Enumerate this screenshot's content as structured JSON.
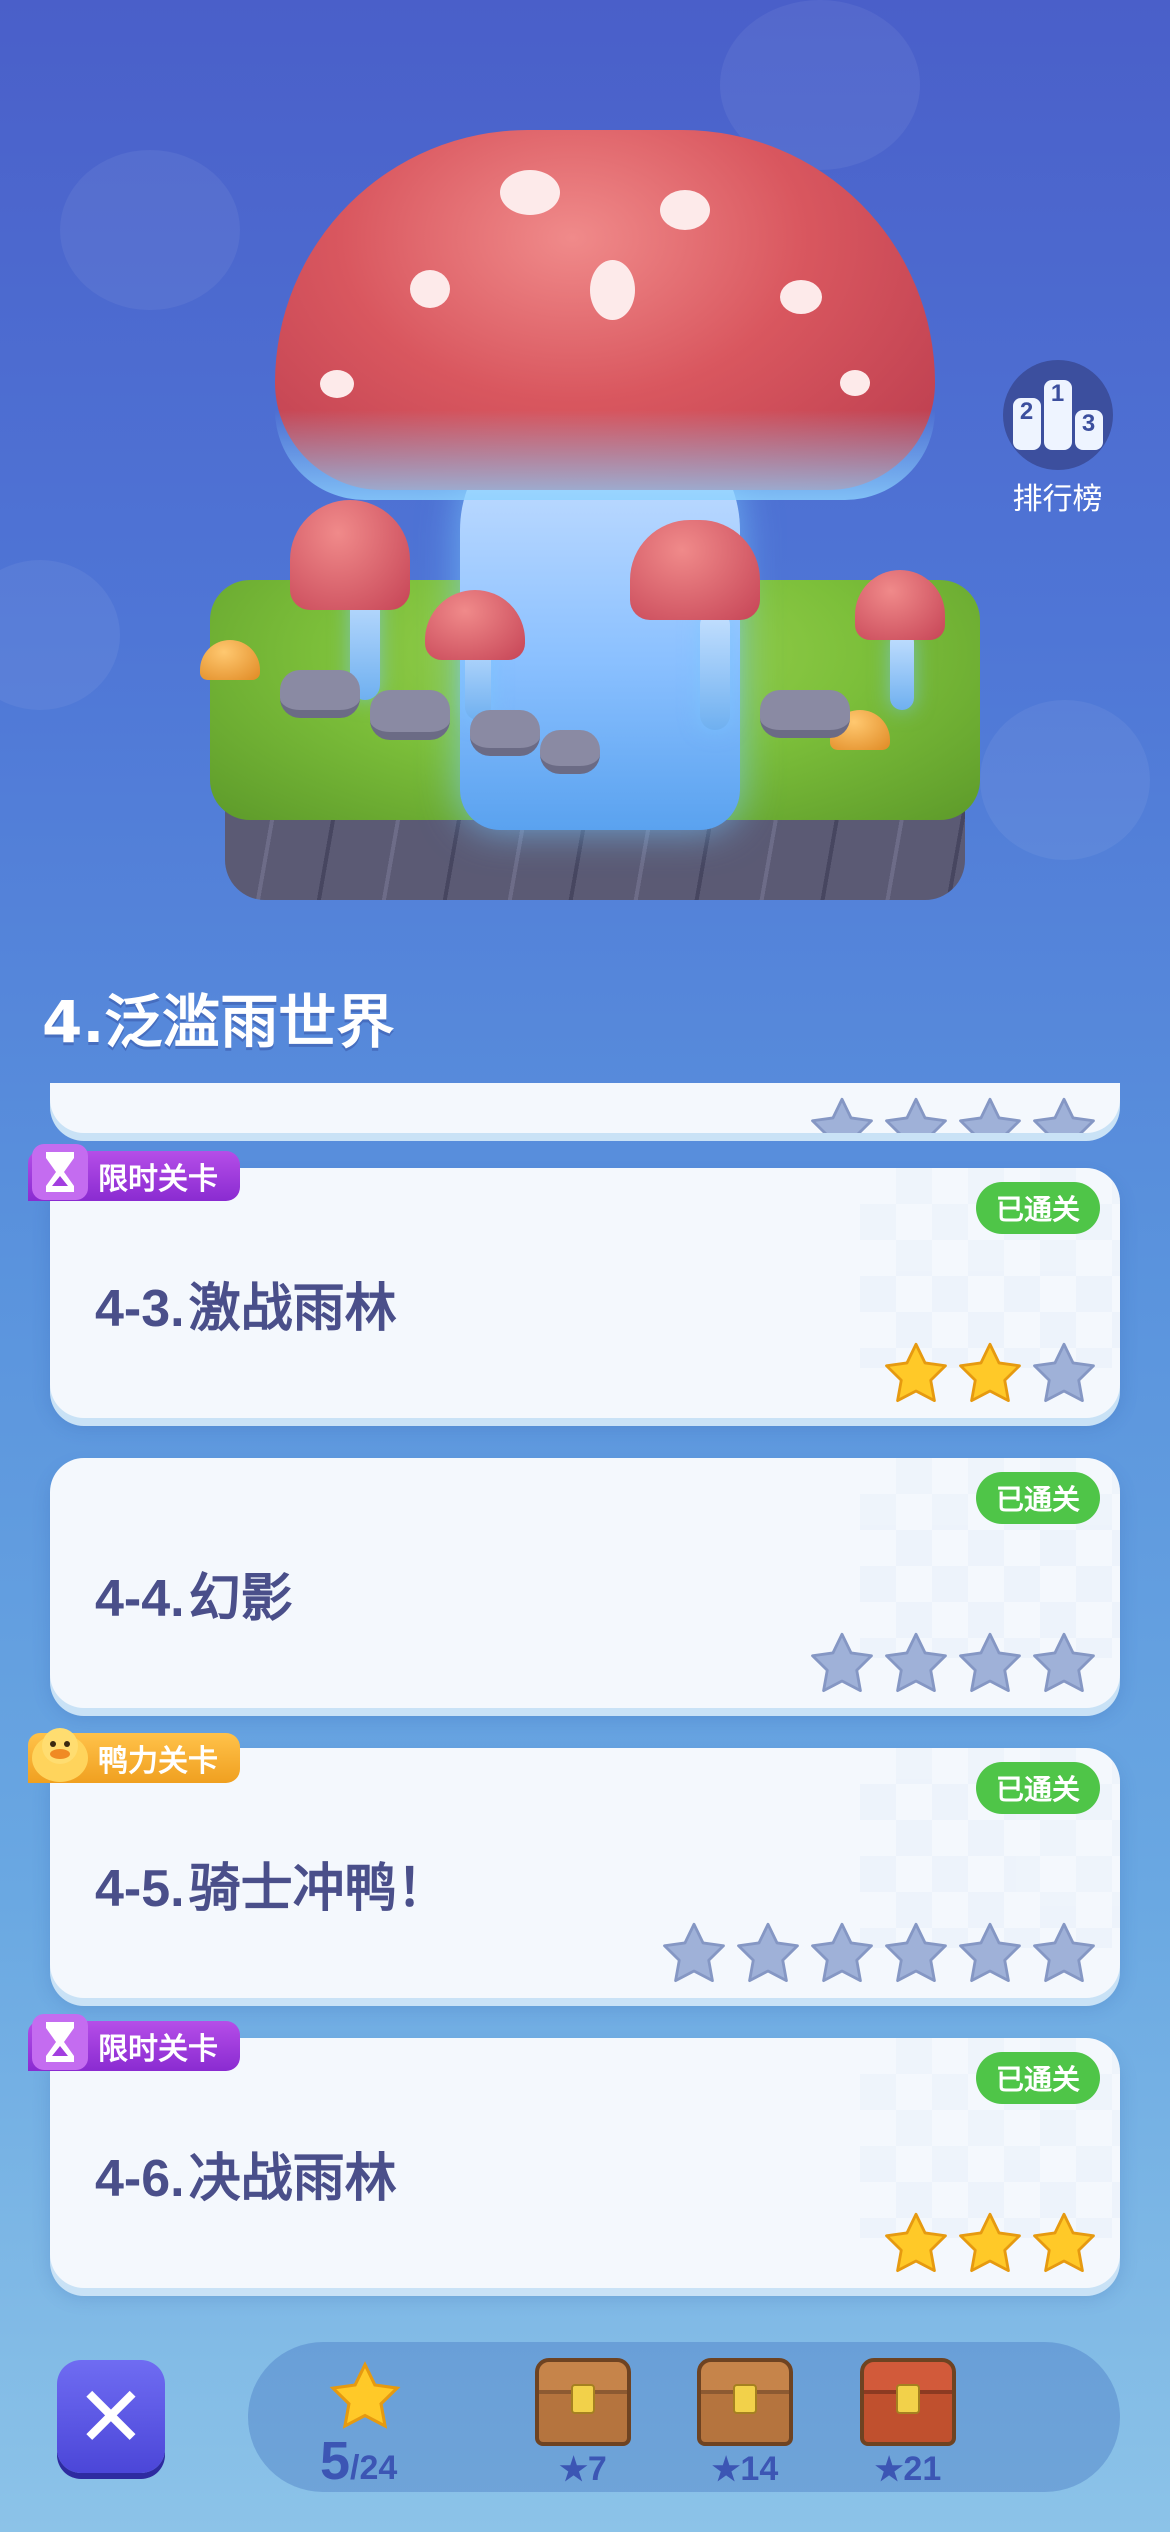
{
  "leaderboard": {
    "label": "排行榜",
    "podium": [
      "2",
      "1",
      "3"
    ]
  },
  "world": {
    "title": "4.泛滥雨世界"
  },
  "levels": [
    {
      "number": "4-3.",
      "name": "激战雨林",
      "tag": "限时关卡",
      "tag_type": "timed",
      "status": "已通关",
      "stars_earned": 2,
      "stars_total": 3
    },
    {
      "number": "4-4.",
      "name": "幻影",
      "tag": "",
      "tag_type": "",
      "status": "已通关",
      "stars_earned": 0,
      "stars_total": 4
    },
    {
      "number": "4-5.",
      "name": "骑士冲鸭！",
      "tag": "鸭力关卡",
      "tag_type": "duck",
      "status": "已通关",
      "stars_earned": 0,
      "stars_total": 6
    },
    {
      "number": "4-6.",
      "name": "决战雨林",
      "tag": "限时关卡",
      "tag_type": "timed",
      "status": "已通关",
      "stars_earned": 3,
      "stars_total": 3
    }
  ],
  "progress": {
    "current": "5",
    "total": "/24"
  },
  "chests": [
    {
      "stars": "7"
    },
    {
      "stars": "14"
    },
    {
      "stars": "21"
    }
  ],
  "colors": {
    "star_gold": "#ffc928",
    "star_empty": "#9fb1d8",
    "passed_green": "#4fc548",
    "timed_purple": "#a23ee0",
    "duck_orange": "#f5b030"
  }
}
